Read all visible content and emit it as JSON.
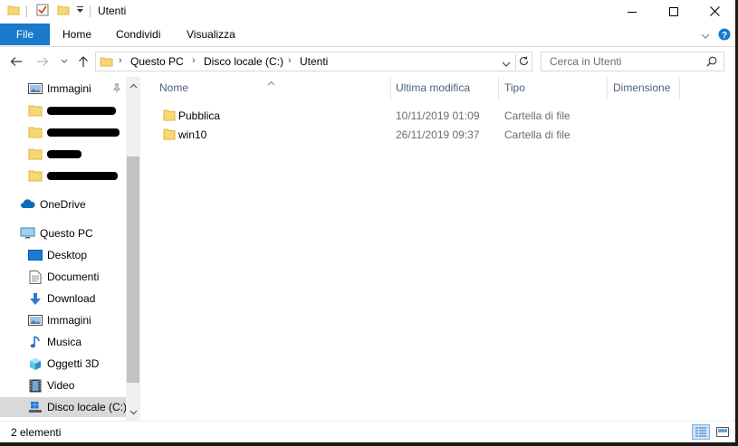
{
  "window": {
    "title": "Utenti"
  },
  "ribbon": {
    "tabs": [
      "File",
      "Home",
      "Condividi",
      "Visualizza"
    ]
  },
  "address": {
    "crumbs": [
      "Questo PC",
      "Disco locale (C:)",
      "Utenti"
    ]
  },
  "search": {
    "placeholder": "Cerca in Utenti"
  },
  "navpane": {
    "quick_access_pinned": "Immagini",
    "onedrive": "OneDrive",
    "this_pc": "Questo PC",
    "items": [
      "Desktop",
      "Documenti",
      "Download",
      "Immagini",
      "Musica",
      "Oggetti 3D",
      "Video",
      "Disco locale (C:)"
    ]
  },
  "columns": {
    "name": "Nome",
    "modified": "Ultima modifica",
    "type": "Tipo",
    "size": "Dimensione"
  },
  "files": [
    {
      "name": "Pubblica",
      "modified": "10/11/2019 01:09",
      "type": "Cartella di file"
    },
    {
      "name": "win10",
      "modified": "26/11/2019 09:37",
      "type": "Cartella di file"
    }
  ],
  "status": {
    "count": "2 elementi"
  },
  "colors": {
    "accent": "#1979ca",
    "folder": "#f8d775",
    "folder_dark": "#e0b53b",
    "selected": "#d9d9d9"
  }
}
